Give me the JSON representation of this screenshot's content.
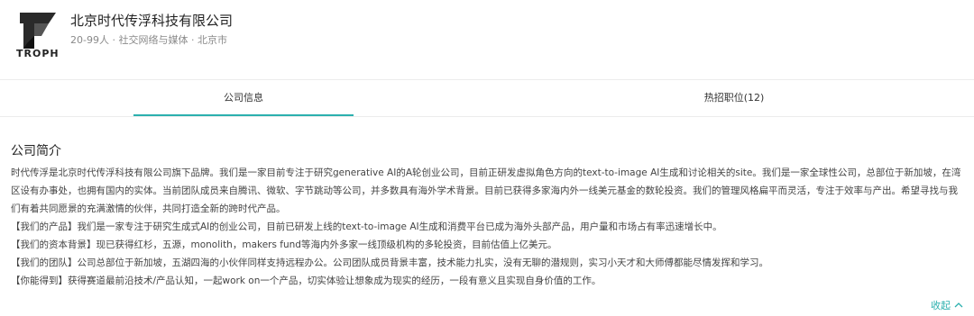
{
  "company": {
    "logo_text": "TROPH",
    "name": "北京时代传浮科技有限公司",
    "meta": "20-99人 · 社交网络与媒体 · 北京市"
  },
  "tabs": [
    {
      "label": "公司信息",
      "active": true
    },
    {
      "label": "热招职位(12)",
      "active": false
    }
  ],
  "intro": {
    "title": "公司简介",
    "paragraphs": [
      "时代传浮是北京时代传浮科技有限公司旗下品牌。我们是一家目前专注于研究generative AI的A轮创业公司，目前正研发虚拟角色方向的text-to-image AI生成和讨论相关的site。我们是一家全球性公司，总部位于新加坡，在湾区设有办事处，也拥有国内的实体。当前团队成员来自腾讯、微软、字节跳动等公司，并多数具有海外学术背景。目前已获得多家海内外一线美元基金的数轮投资。我们的管理风格扁平而灵活，专注于效率与产出。希望寻找与我们有着共同愿景的充满激情的伙伴，共同打造全新的跨时代产品。",
      "【我们的产品】我们是一家专注于研究生成式AI的创业公司，目前已研发上线的text-to-image AI生成和消费平台已成为海外头部产品，用户量和市场占有率迅速增长中。",
      "【我们的资本背景】现已获得红杉，五源，monolith，makers fund等海内外多家一线顶级机构的多轮投资，目前估值上亿美元。",
      "【我们的团队】公司总部位于新加坡，五湖四海的小伙伴同样支持远程办公。公司团队成员背景丰富，技术能力扎实，没有无聊的潜规则，实习小天才和大师傅都能尽情发挥和学习。",
      "【你能得到】获得赛道最前沿技术/产品认知，一起work on一个产品，切实体验让想象成为现实的经历，一段有意义且实现自身价值的工作。"
    ],
    "collapse_label": "收起"
  },
  "colors": {
    "accent": "#2bb0ae"
  }
}
